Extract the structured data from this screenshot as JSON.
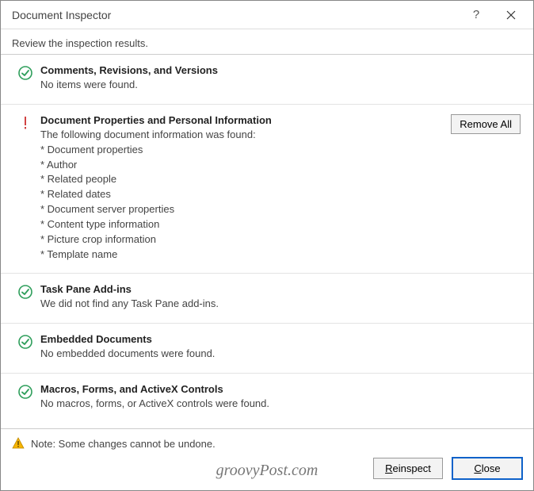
{
  "title": "Document Inspector",
  "instructions": "Review the inspection results.",
  "sections": [
    {
      "status": "ok",
      "heading": "Comments, Revisions, and Versions",
      "desc": "No items were found.",
      "items": [],
      "action": ""
    },
    {
      "status": "warn",
      "heading": "Document Properties and Personal Information",
      "desc": "The following document information was found:",
      "items": [
        "* Document properties",
        "* Author",
        "* Related people",
        "* Related dates",
        "* Document server properties",
        "* Content type information",
        "* Picture crop information",
        "* Template name"
      ],
      "action": "Remove All"
    },
    {
      "status": "ok",
      "heading": "Task Pane Add-ins",
      "desc": "We did not find any Task Pane add-ins.",
      "items": [],
      "action": ""
    },
    {
      "status": "ok",
      "heading": "Embedded Documents",
      "desc": "No embedded documents were found.",
      "items": [],
      "action": ""
    },
    {
      "status": "ok",
      "heading": "Macros, Forms, and ActiveX Controls",
      "desc": "No macros, forms, or ActiveX controls were found.",
      "items": [],
      "action": ""
    }
  ],
  "footer_note": "Note: Some changes cannot be undone.",
  "buttons": {
    "reinspect": "Reinspect",
    "close": "Close"
  },
  "watermark": "groovyPost.com"
}
